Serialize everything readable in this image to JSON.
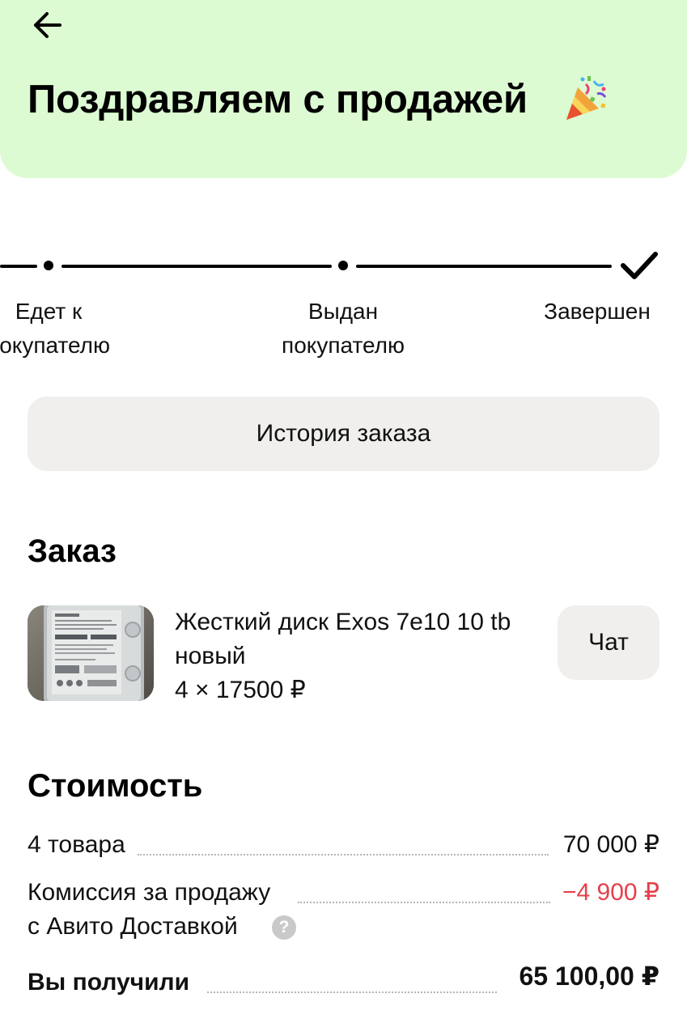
{
  "header": {
    "title": "Поздравляем с продажей",
    "background": "#dcfbd2",
    "back_icon": "arrow-left-icon",
    "celebration_icon": "party-popper-icon"
  },
  "stepper": {
    "steps": [
      {
        "label_line1": "Едет к",
        "label_line2": "покупателю",
        "state": "done"
      },
      {
        "label_line1": "Выдан",
        "label_line2": "покупателю",
        "state": "done"
      },
      {
        "label_line1": "Завершен",
        "label_line2": "",
        "state": "current"
      }
    ]
  },
  "history_button": {
    "label": "История заказа"
  },
  "order": {
    "section_title": "Заказ",
    "product_name": "Жесткий диск Exos 7e10 10 tb новый",
    "quantity_price": "4 × 17500 ₽",
    "chat_label": "Чат"
  },
  "cost": {
    "section_title": "Стоимость",
    "items_label": "4 товара",
    "items_value": "70 000 ₽",
    "fee_label_line1": "Комиссия за продажу",
    "fee_label_line2": "с Авито Доставкой",
    "fee_value": "−4 900 ₽",
    "total_label": "Вы получили",
    "total_value": "65 100,00 ₽",
    "negative_color": "#e5404b"
  }
}
